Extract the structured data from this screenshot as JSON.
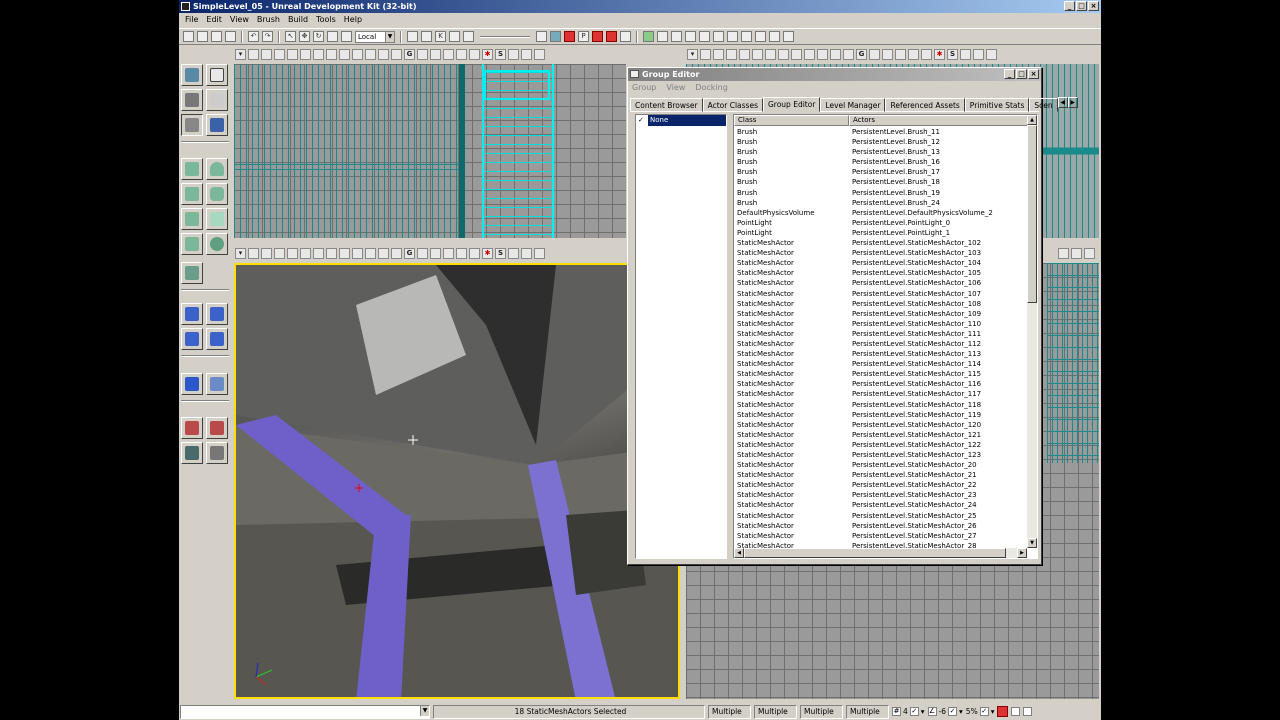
{
  "window": {
    "title": "SimpleLevel_05 - Unreal Development Kit (32-bit)",
    "controls": [
      "_",
      "□",
      "×"
    ]
  },
  "menu": [
    "File",
    "Edit",
    "View",
    "Brush",
    "Build",
    "Tools",
    "Help"
  ],
  "toolbar": {
    "coord_system": "Local"
  },
  "group_editor": {
    "title": "Group Editor",
    "menu": [
      "Group",
      "View",
      "Docking"
    ],
    "tabs": [
      "Content Browser",
      "Actor Classes",
      "Group Editor",
      "Level Manager",
      "Referenced Assets",
      "Primitive Stats",
      "Scen"
    ],
    "active_tab": "Group Editor",
    "groups": [
      {
        "label": "None",
        "checked": true,
        "selected": true
      }
    ],
    "columns": [
      "Class",
      "Actors"
    ],
    "rows": [
      [
        "Brush",
        "PersistentLevel.Brush_11"
      ],
      [
        "Brush",
        "PersistentLevel.Brush_12"
      ],
      [
        "Brush",
        "PersistentLevel.Brush_13"
      ],
      [
        "Brush",
        "PersistentLevel.Brush_16"
      ],
      [
        "Brush",
        "PersistentLevel.Brush_17"
      ],
      [
        "Brush",
        "PersistentLevel.Brush_18"
      ],
      [
        "Brush",
        "PersistentLevel.Brush_19"
      ],
      [
        "Brush",
        "PersistentLevel.Brush_24"
      ],
      [
        "DefaultPhysicsVolume",
        "PersistentLevel.DefaultPhysicsVolume_2"
      ],
      [
        "PointLight",
        "PersistentLevel.PointLight_0"
      ],
      [
        "PointLight",
        "PersistentLevel.PointLight_1"
      ],
      [
        "StaticMeshActor",
        "PersistentLevel.StaticMeshActor_102"
      ],
      [
        "StaticMeshActor",
        "PersistentLevel.StaticMeshActor_103"
      ],
      [
        "StaticMeshActor",
        "PersistentLevel.StaticMeshActor_104"
      ],
      [
        "StaticMeshActor",
        "PersistentLevel.StaticMeshActor_105"
      ],
      [
        "StaticMeshActor",
        "PersistentLevel.StaticMeshActor_106"
      ],
      [
        "StaticMeshActor",
        "PersistentLevel.StaticMeshActor_107"
      ],
      [
        "StaticMeshActor",
        "PersistentLevel.StaticMeshActor_108"
      ],
      [
        "StaticMeshActor",
        "PersistentLevel.StaticMeshActor_109"
      ],
      [
        "StaticMeshActor",
        "PersistentLevel.StaticMeshActor_110"
      ],
      [
        "StaticMeshActor",
        "PersistentLevel.StaticMeshActor_111"
      ],
      [
        "StaticMeshActor",
        "PersistentLevel.StaticMeshActor_112"
      ],
      [
        "StaticMeshActor",
        "PersistentLevel.StaticMeshActor_113"
      ],
      [
        "StaticMeshActor",
        "PersistentLevel.StaticMeshActor_114"
      ],
      [
        "StaticMeshActor",
        "PersistentLevel.StaticMeshActor_115"
      ],
      [
        "StaticMeshActor",
        "PersistentLevel.StaticMeshActor_116"
      ],
      [
        "StaticMeshActor",
        "PersistentLevel.StaticMeshActor_117"
      ],
      [
        "StaticMeshActor",
        "PersistentLevel.StaticMeshActor_118"
      ],
      [
        "StaticMeshActor",
        "PersistentLevel.StaticMeshActor_119"
      ],
      [
        "StaticMeshActor",
        "PersistentLevel.StaticMeshActor_120"
      ],
      [
        "StaticMeshActor",
        "PersistentLevel.StaticMeshActor_121"
      ],
      [
        "StaticMeshActor",
        "PersistentLevel.StaticMeshActor_122"
      ],
      [
        "StaticMeshActor",
        "PersistentLevel.StaticMeshActor_123"
      ],
      [
        "StaticMeshActor",
        "PersistentLevel.StaticMeshActor_20"
      ],
      [
        "StaticMeshActor",
        "PersistentLevel.StaticMeshActor_21"
      ],
      [
        "StaticMeshActor",
        "PersistentLevel.StaticMeshActor_22"
      ],
      [
        "StaticMeshActor",
        "PersistentLevel.StaticMeshActor_23"
      ],
      [
        "StaticMeshActor",
        "PersistentLevel.StaticMeshActor_24"
      ],
      [
        "StaticMeshActor",
        "PersistentLevel.StaticMeshActor_25"
      ],
      [
        "StaticMeshActor",
        "PersistentLevel.StaticMeshActor_26"
      ],
      [
        "StaticMeshActor",
        "PersistentLevel.StaticMeshActor_27"
      ],
      [
        "StaticMeshActor",
        "PersistentLevel.StaticMeshActor_28"
      ]
    ]
  },
  "statusbar": {
    "command": "",
    "selection": "18 StaticMeshActors Selected",
    "fields": [
      "Multiple",
      "Multiple",
      "Multiple",
      "Multiple"
    ],
    "grid_size": "4",
    "rotation_snap": "-6",
    "scale_snap": "5%"
  },
  "colors": {
    "titlebar": "#0a246a",
    "selection": "#0a246a",
    "viewport_active_border": "#ffde00",
    "wire_cyan": "#1b8a8a",
    "volume_purple": "#6e60c8"
  }
}
